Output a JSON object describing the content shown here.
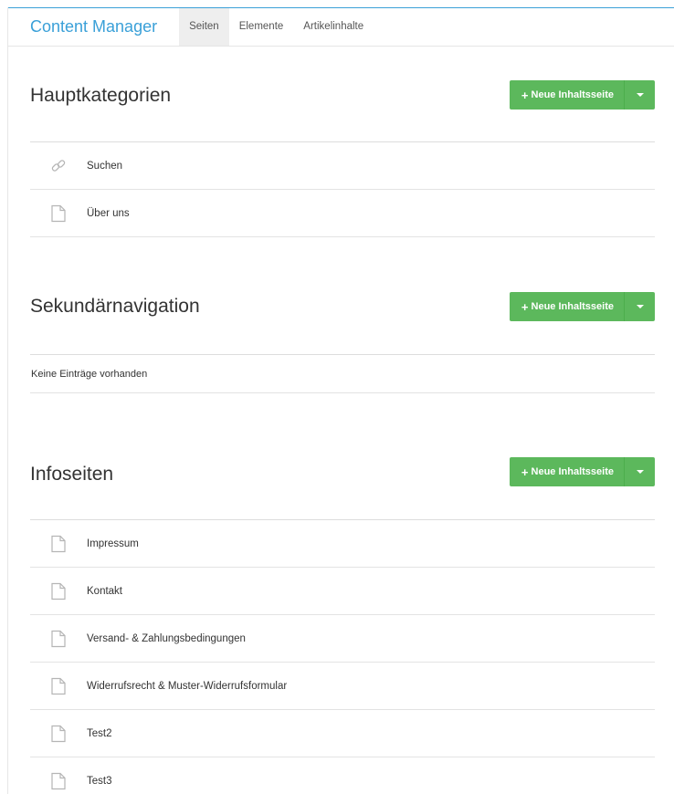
{
  "header": {
    "brand": "Content Manager",
    "tabs": [
      {
        "label": "Seiten",
        "active": true
      },
      {
        "label": "Elemente",
        "active": false
      },
      {
        "label": "Artikelinhalte",
        "active": false
      }
    ]
  },
  "colors": {
    "accent": "#3aa0d8",
    "button_green": "#5cb85c"
  },
  "sections": [
    {
      "title": "Hauptkategorien",
      "button_label": "Neue Inhaltsseite",
      "items": [
        {
          "label": "Suchen",
          "icon": "link-icon"
        },
        {
          "label": "Über uns",
          "icon": "page-icon"
        }
      ]
    },
    {
      "title": "Sekundärnavigation",
      "button_label": "Neue Inhaltsseite",
      "empty_text": "Keine Einträge vorhanden",
      "items": []
    },
    {
      "title": "Infoseiten",
      "button_label": "Neue Inhaltsseite",
      "items": [
        {
          "label": "Impressum",
          "icon": "page-icon"
        },
        {
          "label": "Kontakt",
          "icon": "page-icon"
        },
        {
          "label": "Versand- & Zahlungsbedingungen",
          "icon": "page-icon"
        },
        {
          "label": "Widerrufsrecht & Muster-Widerrufsformular",
          "icon": "page-icon"
        },
        {
          "label": "Test2",
          "icon": "page-icon"
        },
        {
          "label": "Test3",
          "icon": "page-icon"
        }
      ]
    }
  ]
}
